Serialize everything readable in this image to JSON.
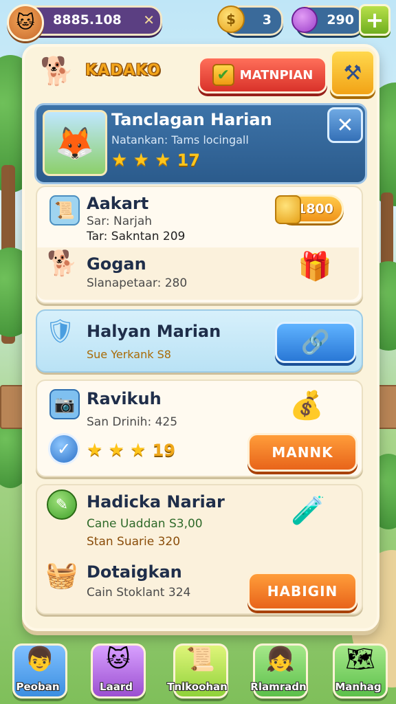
{
  "top_bar": {
    "player_id": "8885.108",
    "close_glyph": "✕",
    "coins": "3",
    "gems": "290",
    "plus_glyph": "+"
  },
  "panel": {
    "logo_text": "KADAKO",
    "main_button_label": "MATNPIAN"
  },
  "header_card": {
    "title": "Tanclagan Harian",
    "subtitle": "Natankan: Tams locingall",
    "stars": "★ ★ ★",
    "star_count": "17"
  },
  "quests": [
    {
      "title": "Aakart",
      "line1": "Sar: Narjah",
      "line2": "Tar: Sakntan 209",
      "reward": "1800"
    },
    {
      "title": "Gogan",
      "line1": "Slanapetaar: 280"
    },
    {
      "title": "Halyan Marian",
      "line1": "Sue Yerkank S8"
    },
    {
      "title": "Ravikuh",
      "line1": "San Drinih: 425",
      "stars": "★ ★ ★",
      "star_count": "19",
      "button_label": "MANNK"
    },
    {
      "title": "Hadicka Nariar",
      "line1": "Cane Uaddan S3,00",
      "line2": "Stan Suarie 320"
    },
    {
      "title": "Dotaigkan",
      "line1": "Cain Stoklant 324",
      "button_label": "HABIGIN"
    }
  ],
  "bottom_nav": [
    {
      "label": "Peoban",
      "icon": "avatar-boy-icon",
      "color": "#3b8ee0"
    },
    {
      "label": "Laard",
      "icon": "cat-icon",
      "color": "#9b4fd0"
    },
    {
      "label": "Tnlkoohan",
      "icon": "scroll-icon",
      "color": "#8fd23a"
    },
    {
      "label": "Rlamradn",
      "icon": "avatar-girl-icon",
      "color": "#5cc04a"
    },
    {
      "label": "Manhag",
      "icon": "map-icon",
      "color": "#5cc04a"
    }
  ],
  "colors": {
    "panel_bg": "#fbf3dc",
    "header_blue": "#2b5b8c",
    "button_orange": "#e8641a",
    "button_red": "#d9322a",
    "button_blue": "#2a78d6"
  }
}
